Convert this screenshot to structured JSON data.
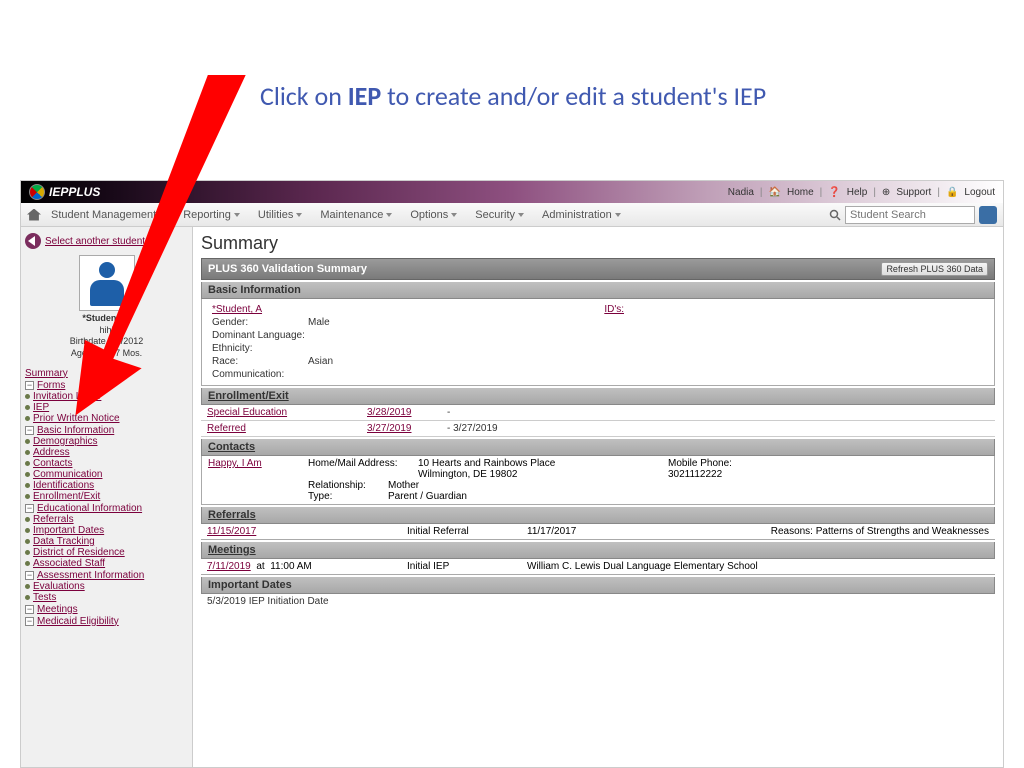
{
  "instruction": {
    "pre": "Click on ",
    "bold": "IEP",
    "post": " to create and/or edit a student's IEP"
  },
  "topbar": {
    "logo": "IEPPLUS",
    "user": "Nadia",
    "links": {
      "home": "Home",
      "help": "Help",
      "support": "Support",
      "logout": "Logout"
    }
  },
  "menubar": {
    "items": [
      "Student Management",
      "Reporting",
      "Utilities",
      "Maintenance",
      "Options",
      "Security",
      "Administration"
    ],
    "search_placeholder": "Student Search"
  },
  "sidebar": {
    "back": "Select another student",
    "student": {
      "name": "*Student, A",
      "line1": "hihi",
      "line2": "Birthdate 1/1/2012",
      "line3": "Age 7 Yrs. 7 Mos."
    },
    "summary": "Summary",
    "sections": [
      {
        "label": "Forms",
        "items": [
          "Invitation Letter",
          "IEP",
          "Prior Written Notice"
        ]
      },
      {
        "label": "Basic Information",
        "items": [
          "Demographics",
          "Address",
          "Contacts",
          "Communication",
          "Identifications",
          "Enrollment/Exit"
        ]
      },
      {
        "label": "Educational Information",
        "items": [
          "Referrals",
          "Important Dates",
          "Data Tracking",
          "District of Residence",
          "Associated Staff"
        ]
      },
      {
        "label": "Assessment Information",
        "items": [
          "Evaluations",
          "Tests"
        ]
      }
    ],
    "extras": [
      "Meetings",
      "Medicaid Eligibility"
    ]
  },
  "main": {
    "title": "Summary",
    "validation_header": "PLUS 360 Validation Summary",
    "refresh": "Refresh PLUS 360 Data",
    "basic": {
      "header": "Basic Information",
      "student_link": "*Student, A",
      "ids": "ID's:",
      "rows": [
        {
          "lbl": "Gender:",
          "val": "Male"
        },
        {
          "lbl": "Dominant Language:",
          "val": ""
        },
        {
          "lbl": "Ethnicity:",
          "val": ""
        },
        {
          "lbl": "Race:",
          "val": "Asian"
        },
        {
          "lbl": "Communication:",
          "val": ""
        }
      ]
    },
    "enrollment": {
      "header": "Enrollment/Exit",
      "rows": [
        {
          "name": "Special Education",
          "date1": "3/28/2019",
          "sep": "-",
          "date2": ""
        },
        {
          "name": "Referred",
          "date1": "3/27/2019",
          "sep": "-",
          "date2": "3/27/2019"
        }
      ]
    },
    "contacts": {
      "header": "Contacts",
      "name": "Happy, I Am",
      "address_lbl": "Home/Mail Address:",
      "address1": "10 Hearts and Rainbows Place",
      "address2": "Wilmington, DE 19802",
      "phone_lbl": "Mobile Phone:",
      "phone": "3021112222",
      "relationship_lbl": "Relationship:",
      "relationship": "Mother",
      "type_lbl": "Type:",
      "type": "Parent / Guardian"
    },
    "referrals": {
      "header": "Referrals",
      "date": "11/15/2017",
      "kind": "Initial Referral",
      "date2": "11/17/2017",
      "reasons_lbl": "Reasons:",
      "reasons": "Patterns of Strengths and Weaknesses"
    },
    "meetings": {
      "header": "Meetings",
      "date": "7/11/2019",
      "at": "at",
      "time": "11:00 AM",
      "type": "Initial IEP",
      "location": "William C. Lewis Dual Language Elementary School"
    },
    "important_dates": {
      "header": "Important Dates",
      "row": "5/3/2019  IEP Initiation Date"
    }
  }
}
